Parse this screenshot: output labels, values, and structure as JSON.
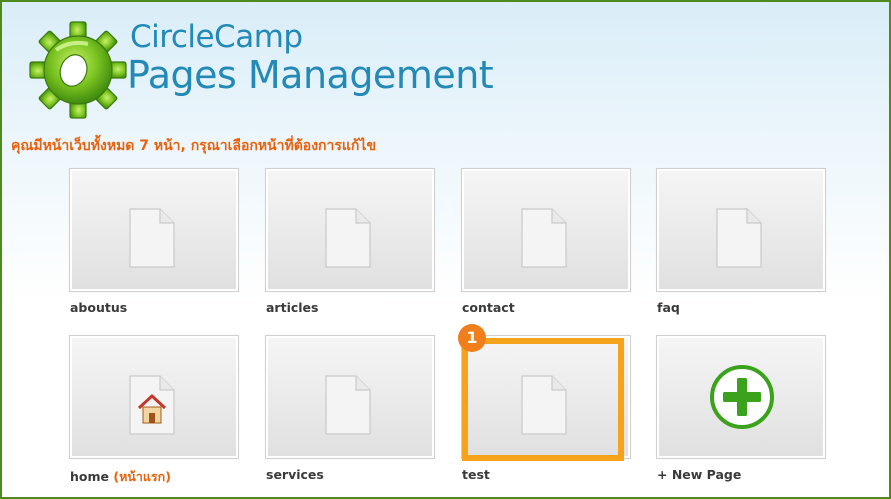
{
  "header": {
    "title_line1": "CircleCamp",
    "title_line2": "Pages Management",
    "subtitle": "คุณมีหน้าเว็บทั้งหมด 7 หน้า, กรุณาเลือกหน้าที่ต้องการแก้ไข"
  },
  "pages": [
    {
      "label": "aboutus",
      "icon": "document-icon"
    },
    {
      "label": "articles",
      "icon": "document-icon"
    },
    {
      "label": "contact",
      "icon": "document-icon"
    },
    {
      "label": "faq",
      "icon": "document-icon"
    },
    {
      "label": "home",
      "note": "(หน้าแรก)",
      "icon": "home-icon"
    },
    {
      "label": "services",
      "icon": "document-icon"
    },
    {
      "label": "test",
      "icon": "document-icon",
      "selected": true
    },
    {
      "label": "+ New Page",
      "icon": "plus-icon"
    }
  ],
  "annotation": {
    "marker_number": "1"
  },
  "colors": {
    "border": "#4e8a1e",
    "title": "#238ab7",
    "subtitle": "#e8620e",
    "highlight": "#f5a31b",
    "plus_green": "#3aa31b"
  }
}
